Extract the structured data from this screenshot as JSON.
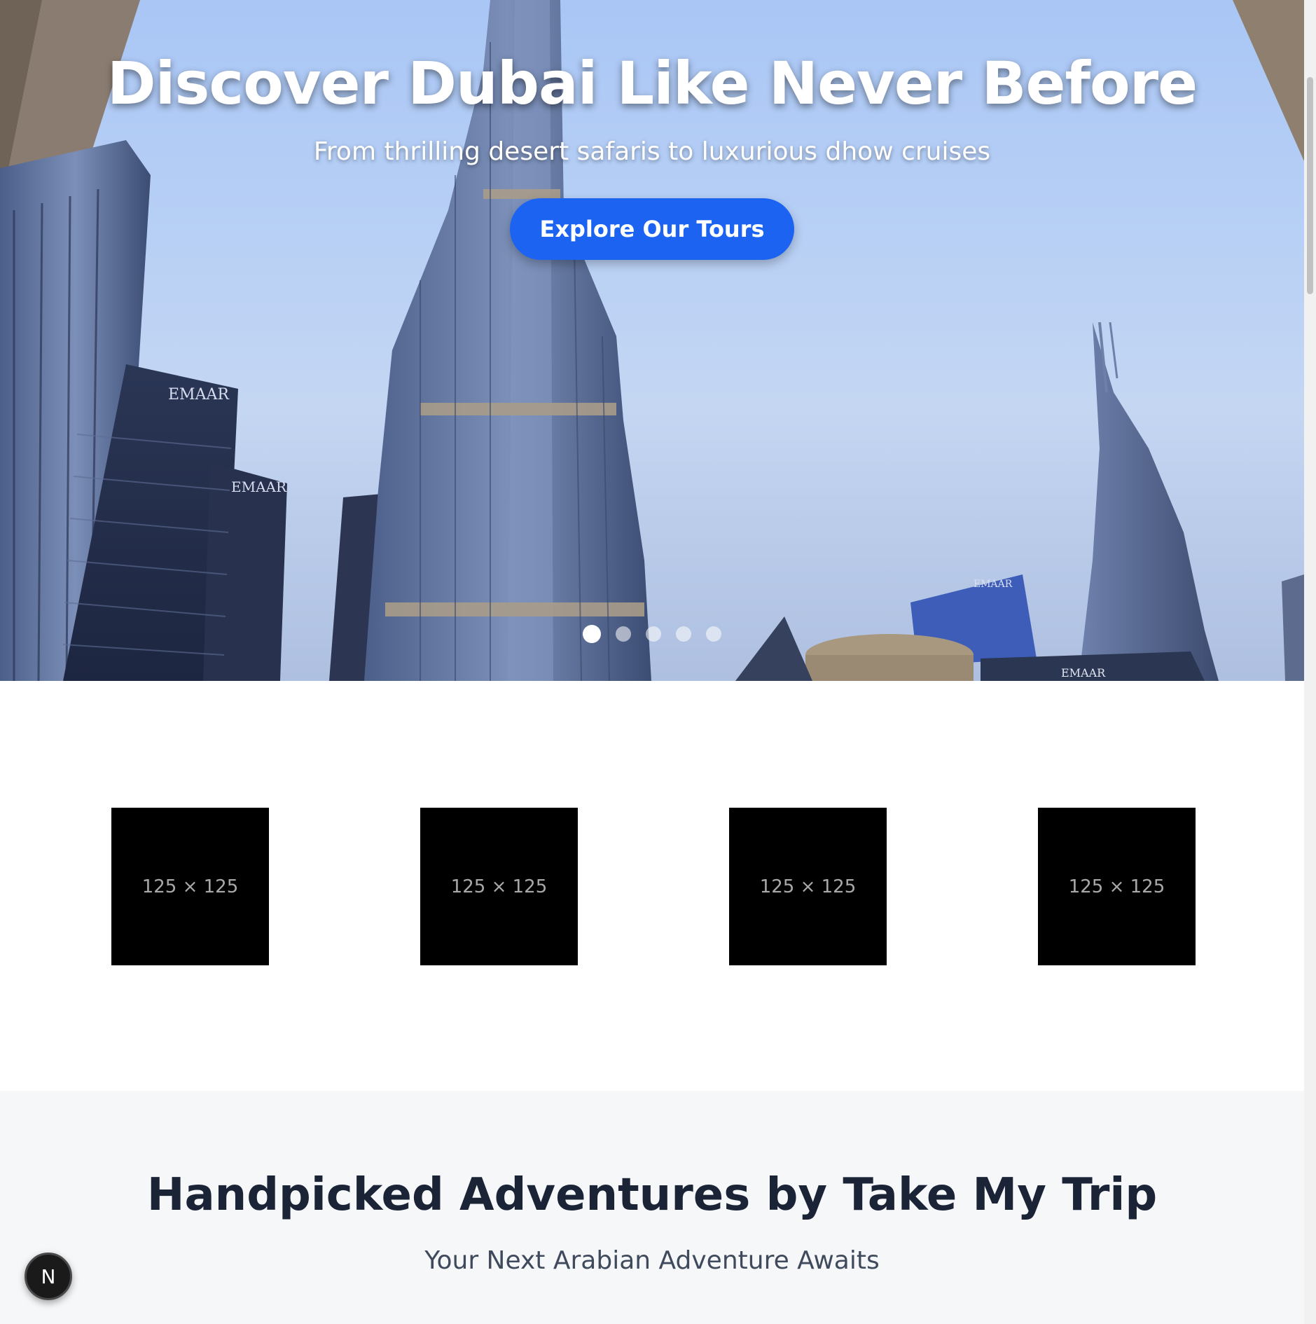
{
  "hero": {
    "title": "Discover Dubai Like Never Before",
    "subtitle": "From thrilling desert safaris to luxurious dhow cruises",
    "cta_label": "Explore Our Tours",
    "slides_count": 5,
    "active_slide": 1,
    "building_signs": [
      "EMAAR",
      "EMAAR",
      "EMAAR",
      "EMAAR"
    ]
  },
  "partners": {
    "logos": [
      {
        "label": "125 × 125"
      },
      {
        "label": "125 × 125"
      },
      {
        "label": "125 × 125"
      },
      {
        "label": "125 × 125"
      }
    ]
  },
  "adventures": {
    "title": "Handpicked Adventures by Take My Trip",
    "subtitle": "Your Next Arabian Adventure Awaits"
  },
  "dev_badge": {
    "label": "N"
  },
  "colors": {
    "accent": "#1c63f2",
    "heading": "#1b2437",
    "section_bg": "#f6f7f9"
  }
}
